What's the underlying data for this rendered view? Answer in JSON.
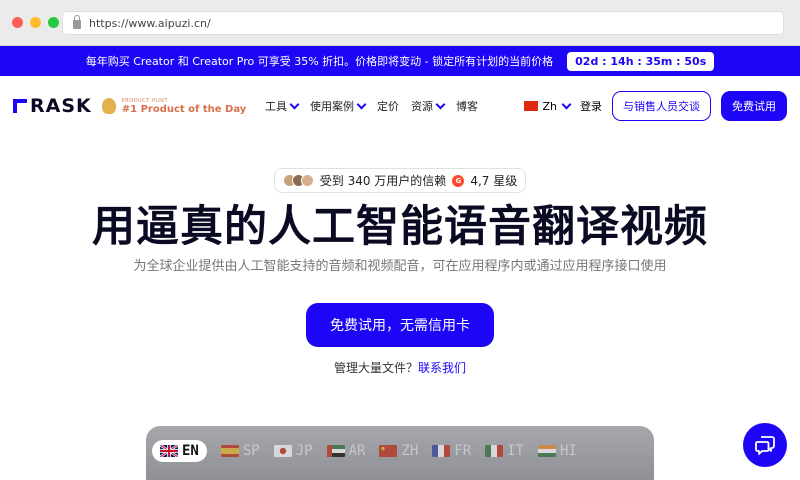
{
  "browser": {
    "url": "https://www.aipuzi.cn/"
  },
  "promo": {
    "text": "每年购买 Creator 和 Creator Pro 可享受 35% 折扣。价格即将变动 - 锁定所有计划的当前价格",
    "timer": "02d : 14h : 35m : 50s"
  },
  "nav": {
    "logo": "RASK",
    "ph_small": "PRODUCT HUNT",
    "ph_big": "#1 Product of the Day",
    "menu": [
      "工具",
      "使用案例",
      "定价",
      "资源",
      "博客"
    ],
    "lang": "Zh",
    "login": "登录",
    "sales": "与销售人员交谈",
    "trial": "免费试用"
  },
  "hero": {
    "trust": "受到 340 万用户的信赖",
    "rating": "4,7 星级",
    "title": "用逼真的人工智能语音翻译视频",
    "subtitle": "为全球企业提供由人工智能支持的音频和视频配音，可在应用程序内或通过应用程序接口使用",
    "cta": "免费试用，无需信用卡",
    "bulk_text": "管理大量文件？",
    "bulk_link": "联系我们"
  },
  "languages": [
    "EN",
    "SP",
    "JP",
    "AR",
    "ZH",
    "FR",
    "IT",
    "HI"
  ],
  "colors": {
    "brand": "#1d06f5"
  }
}
